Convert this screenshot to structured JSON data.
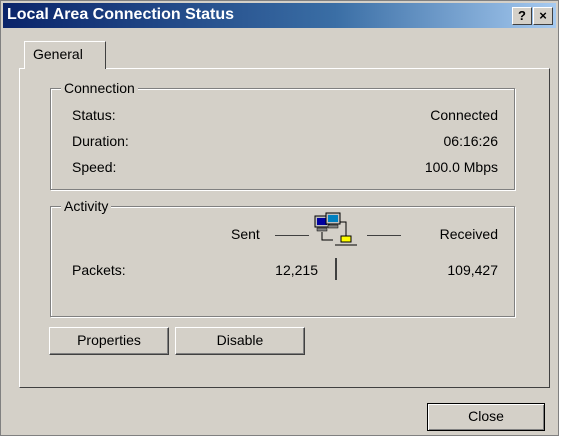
{
  "window": {
    "title": "Local Area Connection Status"
  },
  "titlebar": {
    "help_label": "?",
    "close_label": "×"
  },
  "tabs": [
    {
      "label": "General"
    }
  ],
  "connection": {
    "group_label": "Connection",
    "status_label": "Status:",
    "status_value": "Connected",
    "duration_label": "Duration:",
    "duration_value": "06:16:26",
    "speed_label": "Speed:",
    "speed_value": "100.0 Mbps"
  },
  "activity": {
    "group_label": "Activity",
    "sent_label": "Sent",
    "received_label": "Received",
    "packets_label": "Packets:",
    "packets_sent": "12,215",
    "packets_received": "109,427",
    "icon": "network-computers-icon"
  },
  "buttons": {
    "properties": "Properties",
    "disable": "Disable",
    "close": "Close"
  },
  "colors": {
    "titlebar_start": "#0a246a",
    "titlebar_end": "#a6caf0",
    "face": "#d4d0c8"
  }
}
